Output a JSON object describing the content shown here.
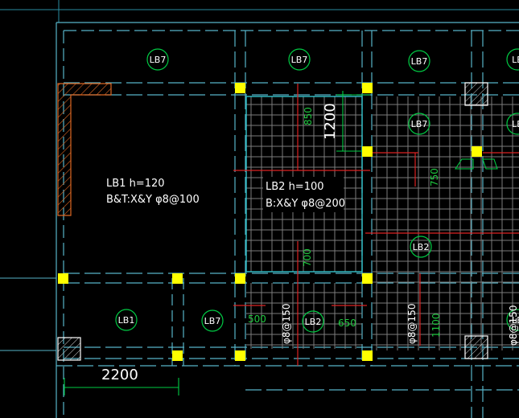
{
  "colors": {
    "background": "#000000",
    "structure_line": "#56b4c8",
    "grid_cyan": "#33c4cc",
    "rebar_grid": "#8a8a8a",
    "dimension_green": "#00cc44",
    "column_yellow": "#ffff00",
    "section_red": "#dd2222",
    "hatch_orange": "#dd6622",
    "label_text": "#ffffff",
    "callout_text": "#20c840"
  },
  "slab_tags": [
    {
      "text": "LB7"
    },
    {
      "text": "LB7"
    },
    {
      "text": "LB7"
    },
    {
      "text": "LB"
    },
    {
      "text": "LB7"
    },
    {
      "text": "LB"
    },
    {
      "text": "LB2"
    },
    {
      "text": "LB1"
    },
    {
      "text": "LB7"
    },
    {
      "text": "LB2"
    },
    {
      "text": "LB"
    }
  ],
  "slab_notes": {
    "lb1_title": "LB1 h=120",
    "lb1_rebar": "B&T:X&Y φ8@100",
    "lb2_title": "LB2 h=100",
    "lb2_rebar": "B:X&Y φ8@200"
  },
  "dimensions": {
    "d1200": "1200",
    "d850": "850",
    "d750": "750",
    "d700": "700",
    "d500": "500",
    "d650": "650",
    "d1100": "1100",
    "d2200": "2200"
  },
  "rebar_marks": {
    "r1": "φ8@150",
    "r2": "φ8@150",
    "r3": "φ8@150"
  }
}
